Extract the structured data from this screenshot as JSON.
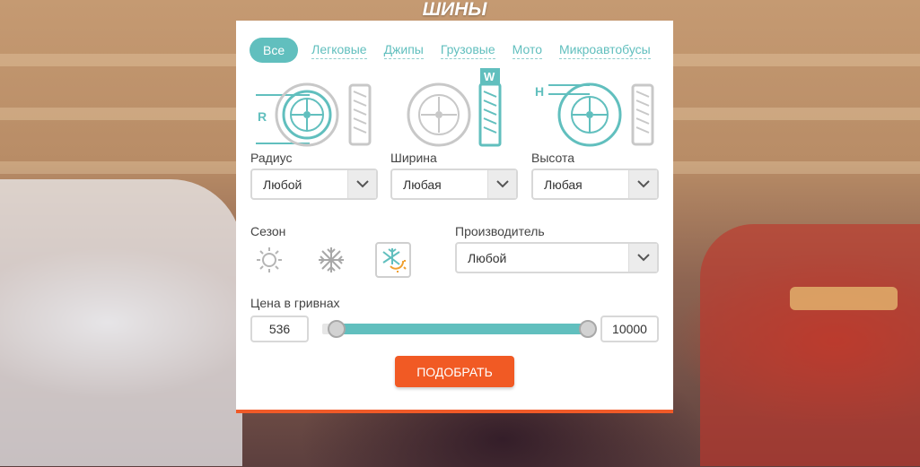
{
  "title": "ШИНЫ",
  "tabs": [
    {
      "label": "Все",
      "active": true
    },
    {
      "label": "Легковые",
      "active": false
    },
    {
      "label": "Джипы",
      "active": false
    },
    {
      "label": "Грузовые",
      "active": false
    },
    {
      "label": "Мото",
      "active": false
    },
    {
      "label": "Микроавтобусы",
      "active": false
    }
  ],
  "dimensions": {
    "radius": {
      "illustration_letter": "R",
      "label": "Радиус",
      "value": "Любой"
    },
    "width": {
      "illustration_letter": "W",
      "label": "Ширина",
      "value": "Любая"
    },
    "height": {
      "illustration_letter": "H",
      "label": "Высота",
      "value": "Любая"
    }
  },
  "season": {
    "label": "Сезон",
    "options": [
      {
        "icon": "sun-icon",
        "selected": false
      },
      {
        "icon": "snowflake-icon",
        "selected": false
      },
      {
        "icon": "all-season-icon",
        "selected": true
      }
    ]
  },
  "manufacturer": {
    "label": "Производитель",
    "value": "Любой"
  },
  "price": {
    "label": "Цена в гривнах",
    "min": "536",
    "max": "10000",
    "range_selected_fraction": [
      0,
      1
    ]
  },
  "submit_label": "ПОДОБРАТЬ",
  "colors": {
    "accent": "#61bfbe",
    "button": "#f15a24",
    "inactive_icon": "#c8c8c8"
  }
}
